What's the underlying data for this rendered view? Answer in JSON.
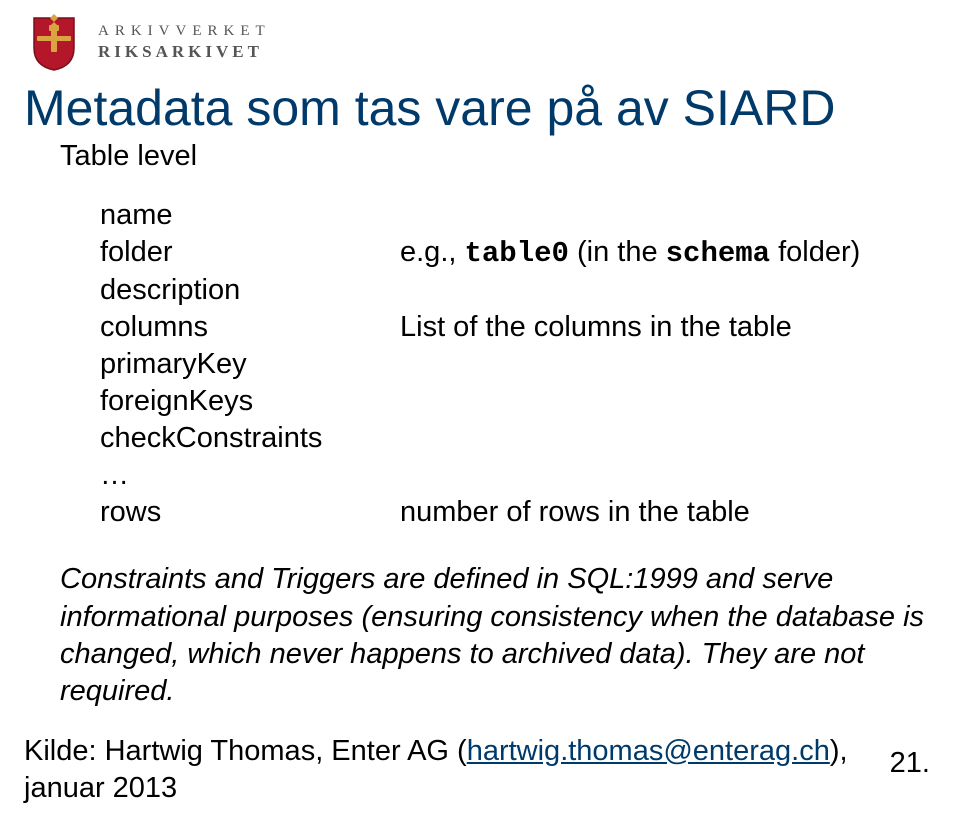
{
  "brand": {
    "line1": "ARKIVVERKET",
    "line2": "RIKSARKIVET"
  },
  "title": "Metadata som tas vare på av SIARD",
  "subtitle": "Table level",
  "definitions": {
    "rows": [
      {
        "key": "name",
        "val": ""
      },
      {
        "key": "folder",
        "val_prefix": "e.g., ",
        "val_mono": "table0",
        "val_mid": " (in the ",
        "val_mono2": "schema",
        "val_suffix": " folder)"
      },
      {
        "key": "description",
        "val": ""
      },
      {
        "key": "columns",
        "val": "List of the columns in the table"
      },
      {
        "key": "primaryKey",
        "val": ""
      },
      {
        "key": "foreignKeys",
        "val": ""
      },
      {
        "key": "checkConstraints",
        "val": ""
      },
      {
        "key": "…",
        "val": ""
      },
      {
        "key": "rows",
        "val": "number of rows in the table"
      }
    ]
  },
  "note": "Constraints and Triggers are defined in SQL:1999 and serve informational purposes (ensuring consistency when the database is changed, which never happens to archived data). They are not required.",
  "source": {
    "prefix": "Kilde: Hartwig Thomas, Enter AG (",
    "link": "hartwig.thomas@enterag.ch",
    "suffix": "), januar 2013"
  },
  "page_number": "21."
}
